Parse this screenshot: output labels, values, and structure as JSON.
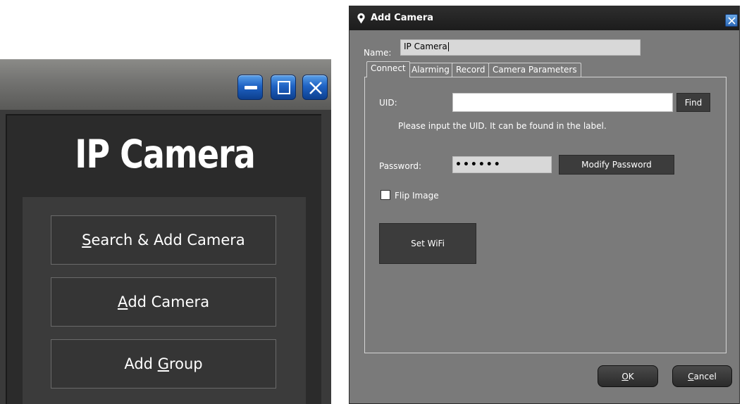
{
  "main_window": {
    "title": "IP Camera",
    "buttons": {
      "search_add_camera": {
        "label_prefix": "",
        "mnemonic": "S",
        "label_suffix": "earch & Add Camera"
      },
      "add_camera": {
        "label_prefix": "",
        "mnemonic": "A",
        "label_suffix": "dd Camera"
      },
      "add_group": {
        "label_prefix": "Add ",
        "mnemonic": "G",
        "label_suffix": "roup"
      }
    },
    "window_controls": [
      "minimize-icon",
      "maximize-icon",
      "close-icon"
    ]
  },
  "dialog": {
    "title": "Add Camera",
    "icon": "location-pin-icon",
    "name_label": "Name:",
    "name_value": "IP Camera",
    "tabs": [
      {
        "label": "Connect",
        "active": true
      },
      {
        "label": "Alarming",
        "active": false
      },
      {
        "label": "Record",
        "active": false
      },
      {
        "label": "Camera Parameters",
        "active": false
      }
    ],
    "connect": {
      "uid_label": "UID:",
      "uid_value": "",
      "find_label": "Find",
      "uid_hint": "Please input the UID. It can be found in the label.",
      "password_label": "Password:",
      "password_value": "••••••",
      "modify_password_label": "Modify Password",
      "flip_image_label": "Flip Image",
      "flip_image_checked": false,
      "set_wifi_label": "Set WiFi"
    },
    "ok": {
      "mnemonic": "O",
      "label_suffix": "K"
    },
    "cancel": {
      "mnemonic": "C",
      "label_suffix": "ancel"
    }
  },
  "colors": {
    "window_accent": "#1f63c4",
    "dialog_background": "#7a7a7a",
    "dark_button": "#3c3c3c"
  }
}
